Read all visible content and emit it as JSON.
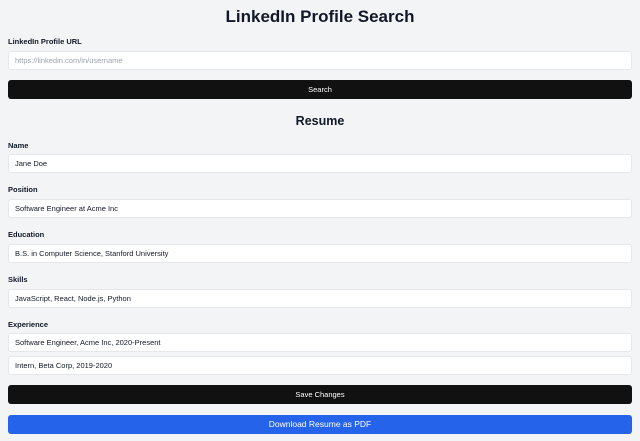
{
  "title": "LinkedIn Profile Search",
  "search": {
    "label": "LinkedIn Profile URL",
    "placeholder": "https://linkedin.com/in/username",
    "value": "",
    "button_label": "Search"
  },
  "resume": {
    "heading": "Resume",
    "name": {
      "label": "Name",
      "value": "Jane Doe"
    },
    "position": {
      "label": "Position",
      "value": "Software Engineer at Acme Inc"
    },
    "education": {
      "label": "Education",
      "value": "B.S. in Computer Science, Stanford University"
    },
    "skills": {
      "label": "Skills",
      "value": "JavaScript, React, Node.js, Python"
    },
    "experience": {
      "label": "Experience",
      "items": [
        "Software Engineer, Acme Inc, 2020-Present",
        "Intern, Beta Corp, 2019-2020"
      ]
    },
    "save_label": "Save Changes",
    "download_label": "Download Resume as PDF"
  }
}
